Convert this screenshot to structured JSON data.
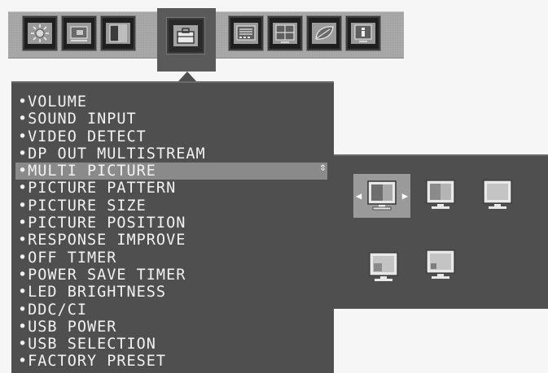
{
  "toolbar": {
    "tabs": [
      {
        "icon": "brightness-icon"
      },
      {
        "icon": "image-adjust-icon"
      },
      {
        "icon": "color-icon"
      },
      {
        "icon": "tools-icon"
      },
      {
        "icon": "menu-tools-icon"
      },
      {
        "icon": "multi-picture-icon"
      },
      {
        "icon": "eco-icon"
      },
      {
        "icon": "information-icon"
      }
    ],
    "selected_index": 3
  },
  "menu": {
    "items": [
      {
        "label": "•VOLUME"
      },
      {
        "label": "•SOUND INPUT"
      },
      {
        "label": "•VIDEO DETECT"
      },
      {
        "label": "•DP OUT MULTISTREAM"
      },
      {
        "label": "•MULTI PICTURE"
      },
      {
        "label": "•PICTURE PATTERN"
      },
      {
        "label": "•PICTURE SIZE"
      },
      {
        "label": "•PICTURE POSITION"
      },
      {
        "label": "•RESPONSE IMPROVE"
      },
      {
        "label": "•OFF TIMER"
      },
      {
        "label": "•POWER SAVE TIMER"
      },
      {
        "label": "•LED BRIGHTNESS"
      },
      {
        "label": "•DDC/CI"
      },
      {
        "label": "•USB POWER"
      },
      {
        "label": "•USB SELECTION"
      },
      {
        "label": "•FACTORY PRESET"
      }
    ],
    "active_index": 4,
    "active_indicator": "⇕"
  },
  "multi_picture": {
    "options": [
      {
        "icon": "single-picture-layout-icon"
      },
      {
        "icon": "picture-by-picture-layout-icon"
      },
      {
        "icon": "picture-by-picture-alt-layout-icon"
      },
      {
        "icon": "picture-in-picture-bottom-left-layout-icon"
      },
      {
        "icon": "picture-in-picture-bottom-left-small-layout-icon"
      }
    ],
    "selected_index": 0,
    "arrow_left": "◀",
    "arrow_right": "▶"
  },
  "colors": {
    "panel": "#4f4f4f",
    "highlight": "#8a8a8a",
    "text": "#f2f2f2"
  }
}
